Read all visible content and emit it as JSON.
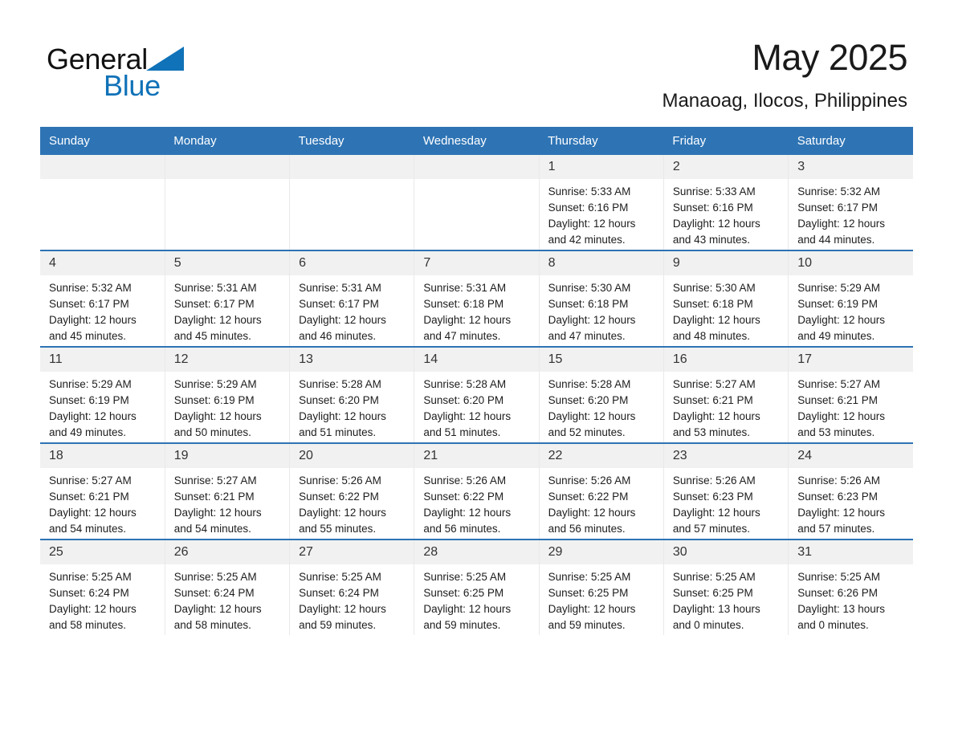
{
  "brand": {
    "name_part1": "General",
    "name_part2": "Blue",
    "accent_color": "#1072b8",
    "triangle_icon": "triangle-icon"
  },
  "header": {
    "title": "May 2025",
    "location": "Manaoag, Ilocos, Philippines"
  },
  "calendar": {
    "header_color": "#2e74b5",
    "weekday_headers": [
      "Sunday",
      "Monday",
      "Tuesday",
      "Wednesday",
      "Thursday",
      "Friday",
      "Saturday"
    ],
    "weeks": [
      [
        {
          "day": "",
          "sunrise": "",
          "sunset": "",
          "daylight_line1": "",
          "daylight_line2": "",
          "blank": true
        },
        {
          "day": "",
          "sunrise": "",
          "sunset": "",
          "daylight_line1": "",
          "daylight_line2": "",
          "blank": true
        },
        {
          "day": "",
          "sunrise": "",
          "sunset": "",
          "daylight_line1": "",
          "daylight_line2": "",
          "blank": true
        },
        {
          "day": "",
          "sunrise": "",
          "sunset": "",
          "daylight_line1": "",
          "daylight_line2": "",
          "blank": true
        },
        {
          "day": "1",
          "sunrise": "Sunrise: 5:33 AM",
          "sunset": "Sunset: 6:16 PM",
          "daylight_line1": "Daylight: 12 hours",
          "daylight_line2": "and 42 minutes.",
          "blank": false
        },
        {
          "day": "2",
          "sunrise": "Sunrise: 5:33 AM",
          "sunset": "Sunset: 6:16 PM",
          "daylight_line1": "Daylight: 12 hours",
          "daylight_line2": "and 43 minutes.",
          "blank": false
        },
        {
          "day": "3",
          "sunrise": "Sunrise: 5:32 AM",
          "sunset": "Sunset: 6:17 PM",
          "daylight_line1": "Daylight: 12 hours",
          "daylight_line2": "and 44 minutes.",
          "blank": false
        }
      ],
      [
        {
          "day": "4",
          "sunrise": "Sunrise: 5:32 AM",
          "sunset": "Sunset: 6:17 PM",
          "daylight_line1": "Daylight: 12 hours",
          "daylight_line2": "and 45 minutes.",
          "blank": false
        },
        {
          "day": "5",
          "sunrise": "Sunrise: 5:31 AM",
          "sunset": "Sunset: 6:17 PM",
          "daylight_line1": "Daylight: 12 hours",
          "daylight_line2": "and 45 minutes.",
          "blank": false
        },
        {
          "day": "6",
          "sunrise": "Sunrise: 5:31 AM",
          "sunset": "Sunset: 6:17 PM",
          "daylight_line1": "Daylight: 12 hours",
          "daylight_line2": "and 46 minutes.",
          "blank": false
        },
        {
          "day": "7",
          "sunrise": "Sunrise: 5:31 AM",
          "sunset": "Sunset: 6:18 PM",
          "daylight_line1": "Daylight: 12 hours",
          "daylight_line2": "and 47 minutes.",
          "blank": false
        },
        {
          "day": "8",
          "sunrise": "Sunrise: 5:30 AM",
          "sunset": "Sunset: 6:18 PM",
          "daylight_line1": "Daylight: 12 hours",
          "daylight_line2": "and 47 minutes.",
          "blank": false
        },
        {
          "day": "9",
          "sunrise": "Sunrise: 5:30 AM",
          "sunset": "Sunset: 6:18 PM",
          "daylight_line1": "Daylight: 12 hours",
          "daylight_line2": "and 48 minutes.",
          "blank": false
        },
        {
          "day": "10",
          "sunrise": "Sunrise: 5:29 AM",
          "sunset": "Sunset: 6:19 PM",
          "daylight_line1": "Daylight: 12 hours",
          "daylight_line2": "and 49 minutes.",
          "blank": false
        }
      ],
      [
        {
          "day": "11",
          "sunrise": "Sunrise: 5:29 AM",
          "sunset": "Sunset: 6:19 PM",
          "daylight_line1": "Daylight: 12 hours",
          "daylight_line2": "and 49 minutes.",
          "blank": false
        },
        {
          "day": "12",
          "sunrise": "Sunrise: 5:29 AM",
          "sunset": "Sunset: 6:19 PM",
          "daylight_line1": "Daylight: 12 hours",
          "daylight_line2": "and 50 minutes.",
          "blank": false
        },
        {
          "day": "13",
          "sunrise": "Sunrise: 5:28 AM",
          "sunset": "Sunset: 6:20 PM",
          "daylight_line1": "Daylight: 12 hours",
          "daylight_line2": "and 51 minutes.",
          "blank": false
        },
        {
          "day": "14",
          "sunrise": "Sunrise: 5:28 AM",
          "sunset": "Sunset: 6:20 PM",
          "daylight_line1": "Daylight: 12 hours",
          "daylight_line2": "and 51 minutes.",
          "blank": false
        },
        {
          "day": "15",
          "sunrise": "Sunrise: 5:28 AM",
          "sunset": "Sunset: 6:20 PM",
          "daylight_line1": "Daylight: 12 hours",
          "daylight_line2": "and 52 minutes.",
          "blank": false
        },
        {
          "day": "16",
          "sunrise": "Sunrise: 5:27 AM",
          "sunset": "Sunset: 6:21 PM",
          "daylight_line1": "Daylight: 12 hours",
          "daylight_line2": "and 53 minutes.",
          "blank": false
        },
        {
          "day": "17",
          "sunrise": "Sunrise: 5:27 AM",
          "sunset": "Sunset: 6:21 PM",
          "daylight_line1": "Daylight: 12 hours",
          "daylight_line2": "and 53 minutes.",
          "blank": false
        }
      ],
      [
        {
          "day": "18",
          "sunrise": "Sunrise: 5:27 AM",
          "sunset": "Sunset: 6:21 PM",
          "daylight_line1": "Daylight: 12 hours",
          "daylight_line2": "and 54 minutes.",
          "blank": false
        },
        {
          "day": "19",
          "sunrise": "Sunrise: 5:27 AM",
          "sunset": "Sunset: 6:21 PM",
          "daylight_line1": "Daylight: 12 hours",
          "daylight_line2": "and 54 minutes.",
          "blank": false
        },
        {
          "day": "20",
          "sunrise": "Sunrise: 5:26 AM",
          "sunset": "Sunset: 6:22 PM",
          "daylight_line1": "Daylight: 12 hours",
          "daylight_line2": "and 55 minutes.",
          "blank": false
        },
        {
          "day": "21",
          "sunrise": "Sunrise: 5:26 AM",
          "sunset": "Sunset: 6:22 PM",
          "daylight_line1": "Daylight: 12 hours",
          "daylight_line2": "and 56 minutes.",
          "blank": false
        },
        {
          "day": "22",
          "sunrise": "Sunrise: 5:26 AM",
          "sunset": "Sunset: 6:22 PM",
          "daylight_line1": "Daylight: 12 hours",
          "daylight_line2": "and 56 minutes.",
          "blank": false
        },
        {
          "day": "23",
          "sunrise": "Sunrise: 5:26 AM",
          "sunset": "Sunset: 6:23 PM",
          "daylight_line1": "Daylight: 12 hours",
          "daylight_line2": "and 57 minutes.",
          "blank": false
        },
        {
          "day": "24",
          "sunrise": "Sunrise: 5:26 AM",
          "sunset": "Sunset: 6:23 PM",
          "daylight_line1": "Daylight: 12 hours",
          "daylight_line2": "and 57 minutes.",
          "blank": false
        }
      ],
      [
        {
          "day": "25",
          "sunrise": "Sunrise: 5:25 AM",
          "sunset": "Sunset: 6:24 PM",
          "daylight_line1": "Daylight: 12 hours",
          "daylight_line2": "and 58 minutes.",
          "blank": false
        },
        {
          "day": "26",
          "sunrise": "Sunrise: 5:25 AM",
          "sunset": "Sunset: 6:24 PM",
          "daylight_line1": "Daylight: 12 hours",
          "daylight_line2": "and 58 minutes.",
          "blank": false
        },
        {
          "day": "27",
          "sunrise": "Sunrise: 5:25 AM",
          "sunset": "Sunset: 6:24 PM",
          "daylight_line1": "Daylight: 12 hours",
          "daylight_line2": "and 59 minutes.",
          "blank": false
        },
        {
          "day": "28",
          "sunrise": "Sunrise: 5:25 AM",
          "sunset": "Sunset: 6:25 PM",
          "daylight_line1": "Daylight: 12 hours",
          "daylight_line2": "and 59 minutes.",
          "blank": false
        },
        {
          "day": "29",
          "sunrise": "Sunrise: 5:25 AM",
          "sunset": "Sunset: 6:25 PM",
          "daylight_line1": "Daylight: 12 hours",
          "daylight_line2": "and 59 minutes.",
          "blank": false
        },
        {
          "day": "30",
          "sunrise": "Sunrise: 5:25 AM",
          "sunset": "Sunset: 6:25 PM",
          "daylight_line1": "Daylight: 13 hours",
          "daylight_line2": "and 0 minutes.",
          "blank": false
        },
        {
          "day": "31",
          "sunrise": "Sunrise: 5:25 AM",
          "sunset": "Sunset: 6:26 PM",
          "daylight_line1": "Daylight: 13 hours",
          "daylight_line2": "and 0 minutes.",
          "blank": false
        }
      ]
    ]
  }
}
